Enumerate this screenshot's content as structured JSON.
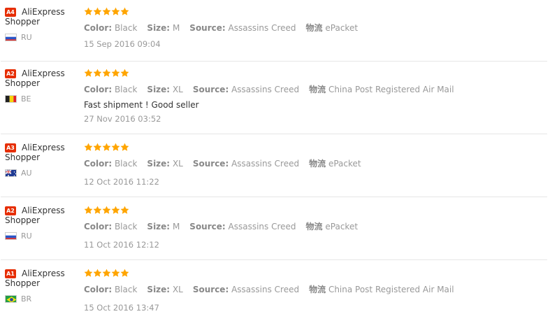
{
  "labels": {
    "color": "Color:",
    "size": "Size:",
    "source": "Source:",
    "logistics": "物流"
  },
  "reviews": [
    {
      "badge": "A4",
      "name_line1": "AliExpress",
      "name_line2": "Shopper",
      "country": "RU",
      "flag": "ru",
      "rating": 5,
      "color": "Black",
      "size": "M",
      "source": "Assassins Creed",
      "logistics": "ePacket",
      "comment": "",
      "date": "15 Sep 2016 09:04"
    },
    {
      "badge": "A2",
      "name_line1": "AliExpress",
      "name_line2": "Shopper",
      "country": "BE",
      "flag": "be",
      "rating": 5,
      "color": "Black",
      "size": "XL",
      "source": "Assassins Creed",
      "logistics": "China Post Registered Air Mail",
      "comment": "Fast shipment ! Good seller",
      "date": "27 Nov 2016 03:52"
    },
    {
      "badge": "A3",
      "name_line1": "AliExpress",
      "name_line2": "Shopper",
      "country": "AU",
      "flag": "au",
      "rating": 5,
      "color": "Black",
      "size": "XL",
      "source": "Assassins Creed",
      "logistics": "ePacket",
      "comment": "",
      "date": "12 Oct 2016 11:22"
    },
    {
      "badge": "A2",
      "name_line1": "AliExpress",
      "name_line2": "Shopper",
      "country": "RU",
      "flag": "ru",
      "rating": 5,
      "color": "Black",
      "size": "M",
      "source": "Assassins Creed",
      "logistics": "ePacket",
      "comment": "",
      "date": "11 Oct 2016 12:12"
    },
    {
      "badge": "A1",
      "name_line1": "AliExpress",
      "name_line2": "Shopper",
      "country": "BR",
      "flag": "br",
      "rating": 5,
      "color": "Black",
      "size": "XL",
      "source": "Assassins Creed",
      "logistics": "China Post Registered Air Mail",
      "comment": "",
      "date": "15 Oct 2016 13:47"
    }
  ]
}
